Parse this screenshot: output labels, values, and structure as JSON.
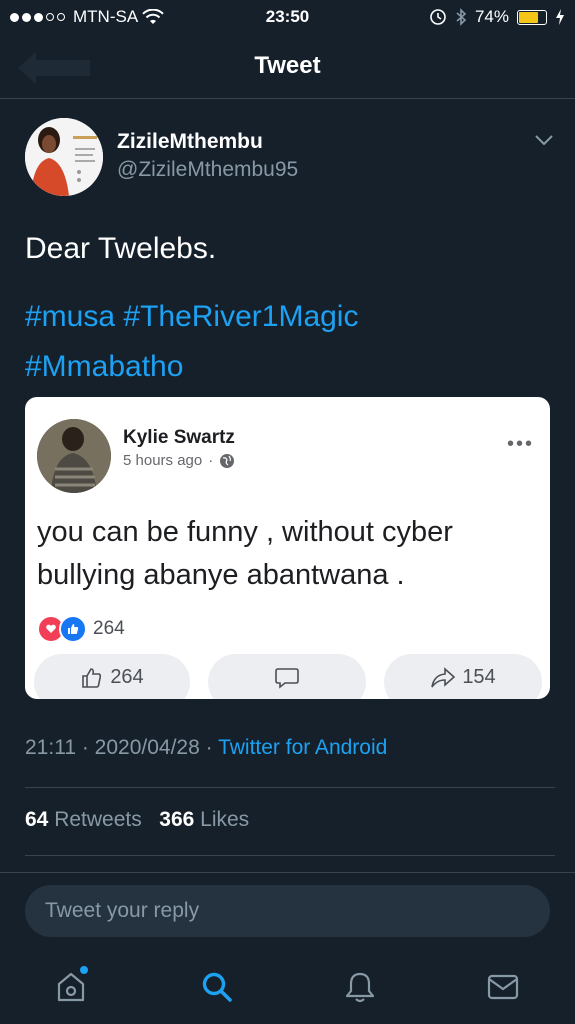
{
  "status_bar": {
    "carrier": "MTN-SA",
    "time": "23:50",
    "battery_percent": "74%",
    "battery_level": 0.74
  },
  "nav": {
    "title": "Tweet"
  },
  "author": {
    "name": "ZizileMthembu",
    "handle": "@ZizileMthembu95"
  },
  "tweet": {
    "text": "Dear Twelebs.",
    "hashtags_line1": "#musa #TheRiver1Magic",
    "hashtags_line2": "#Mmabatho"
  },
  "embed": {
    "name": "Kylie Swartz",
    "time": "5 hours ago",
    "dot": "·",
    "more": "•••",
    "text": "you can be funny , without cyber bullying abanye abantwana .",
    "reactions_count": "264",
    "like_count": "264",
    "share_count": "154"
  },
  "meta": {
    "time": "21:11",
    "sep1": " · ",
    "date": "2020/04/28",
    "sep2": " · ",
    "source": "Twitter for Android"
  },
  "stats": {
    "retweets_count": "64",
    "retweets_label": "Retweets",
    "likes_count": "366",
    "likes_label": "Likes"
  },
  "reply": {
    "placeholder": "Tweet your reply"
  },
  "colors": {
    "background": "#15202b",
    "accent": "#1da1f2",
    "secondary_text": "#8899a6"
  },
  "icons": [
    "wifi-icon",
    "alarm-icon",
    "bluetooth-icon",
    "battery-icon",
    "back-arrow-icon",
    "chevron-down-icon",
    "globe-icon",
    "heart-reaction-icon",
    "like-reaction-icon",
    "thumbs-up-icon",
    "comment-icon",
    "share-icon",
    "home-icon",
    "search-icon",
    "bell-icon",
    "mail-icon"
  ]
}
